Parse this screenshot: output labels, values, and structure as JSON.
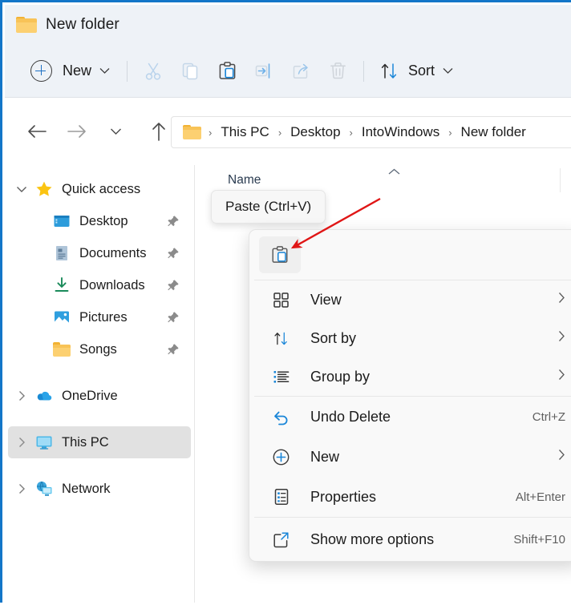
{
  "window": {
    "title": "New folder",
    "accent_color": "#1376c8",
    "titlebar_bg": "#eef2f7"
  },
  "toolbar": {
    "new_label": "New",
    "new_caret": "⌄",
    "buttons": [
      {
        "name": "cut-button",
        "icon": "scissors-icon",
        "label": "Cut"
      },
      {
        "name": "copy-button",
        "icon": "copy-icon",
        "label": "Copy"
      },
      {
        "name": "paste-button",
        "icon": "paste-icon",
        "label": "Paste"
      },
      {
        "name": "rename-button",
        "icon": "rename-icon",
        "label": "Rename"
      },
      {
        "name": "share-button",
        "icon": "share-icon",
        "label": "Share"
      },
      {
        "name": "delete-button",
        "icon": "trash-icon",
        "label": "Delete"
      }
    ],
    "sort_label": "Sort",
    "sort_caret": "⌄"
  },
  "address": {
    "back_icon": "arrow-left-icon",
    "forward_icon": "arrow-right-icon",
    "recent_icon": "chevron-down-icon",
    "up_icon": "arrow-up-icon",
    "breadcrumb": [
      "This PC",
      "Desktop",
      "IntoWindows",
      "New folder"
    ],
    "separator": "›"
  },
  "sidebar": {
    "items": [
      {
        "label": "Quick access",
        "icon": "star-icon",
        "twisty": "chevron-down-icon",
        "pinned": false,
        "selected": false,
        "indent": 0
      },
      {
        "label": "Desktop",
        "icon": "desktop-icon",
        "twisty": "",
        "pinned": true,
        "selected": false,
        "indent": 1
      },
      {
        "label": "Documents",
        "icon": "documents-icon",
        "twisty": "",
        "pinned": true,
        "selected": false,
        "indent": 1
      },
      {
        "label": "Downloads",
        "icon": "downloads-icon",
        "twisty": "",
        "pinned": true,
        "selected": false,
        "indent": 1
      },
      {
        "label": "Pictures",
        "icon": "pictures-icon",
        "twisty": "",
        "pinned": true,
        "selected": false,
        "indent": 1
      },
      {
        "label": "Songs",
        "icon": "folder-icon",
        "twisty": "",
        "pinned": true,
        "selected": false,
        "indent": 1
      },
      {
        "label": "OneDrive",
        "icon": "onedrive-cloud-icon",
        "twisty": "chevron-right-icon",
        "pinned": false,
        "selected": false,
        "indent": 0
      },
      {
        "label": "This PC",
        "icon": "this-pc-icon",
        "twisty": "chevron-right-icon",
        "pinned": false,
        "selected": true,
        "indent": 0
      },
      {
        "label": "Network",
        "icon": "network-icon",
        "twisty": "chevron-right-icon",
        "pinned": false,
        "selected": false,
        "indent": 0
      }
    ]
  },
  "file_list": {
    "columns": [
      {
        "label": "Name",
        "sort_indicator": "chevron-up-icon"
      }
    ]
  },
  "tooltip": {
    "text": "Paste (Ctrl+V)"
  },
  "annotation": {
    "arrow_color": "#e01616",
    "points_to": "paste-icon"
  },
  "context_menu": {
    "top_actions": [
      {
        "name": "paste-icon-button",
        "icon": "paste-icon",
        "label": "Paste",
        "hovered": true
      }
    ],
    "items": [
      {
        "label": "View",
        "icon": "view-grid-icon",
        "accel": "",
        "submenu": true
      },
      {
        "label": "Sort by",
        "icon": "sort-arrows-icon",
        "accel": "",
        "submenu": true
      },
      {
        "label": "Group by",
        "icon": "group-list-icon",
        "accel": "",
        "submenu": true
      },
      {
        "label": "Undo Delete",
        "icon": "undo-icon",
        "accel": "Ctrl+Z",
        "submenu": false
      },
      {
        "label": "New",
        "icon": "plus-circle-icon",
        "accel": "",
        "submenu": true
      },
      {
        "label": "Properties",
        "icon": "properties-icon",
        "accel": "Alt+Enter",
        "submenu": false
      },
      {
        "label": "Show more options",
        "icon": "show-more-icon",
        "accel": "Shift+F10",
        "submenu": false
      }
    ],
    "separator_after": [
      2,
      5
    ],
    "chevron": "›"
  }
}
